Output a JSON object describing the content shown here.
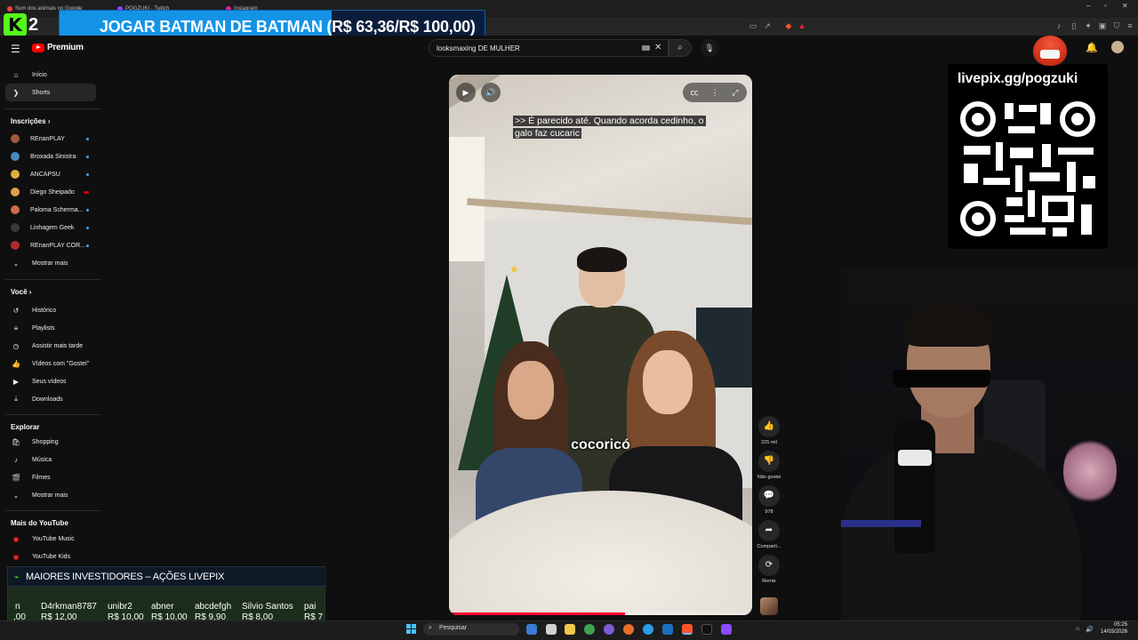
{
  "browser": {
    "tabs": [
      {
        "label": "Som dos animais no Google"
      },
      {
        "label": "POGZUKI - Twitch"
      },
      {
        "label": "Instagram"
      }
    ]
  },
  "stream_banner": {
    "brand": "K2",
    "text": "JOGAR BATMAN DE BATMAN (R$ 63,36/R$ 100,00)",
    "progress_fraction": 0.634
  },
  "header": {
    "logo_text": "Premium",
    "search_value": "looksmaxing DE MULHER"
  },
  "sidebar": {
    "top": [
      {
        "label": "Início",
        "icon": "home-icon"
      },
      {
        "label": "Shorts",
        "icon": "shorts-icon",
        "active": true
      }
    ],
    "subscriptions_title": "Inscrições",
    "subscriptions": [
      {
        "label": "REnanPLAY",
        "color": "#a05a3a",
        "indicator": "live-dot"
      },
      {
        "label": "Broxada Sinistra",
        "color": "#4a8bbd",
        "indicator": "live-dot"
      },
      {
        "label": "ANCAPSU",
        "color": "#e0b13a",
        "indicator": "live-dot"
      },
      {
        "label": "Diego Sheipado",
        "color": "#e0a04a",
        "indicator": "live-red"
      },
      {
        "label": "Paloma Scherma...",
        "color": "#d06a4a",
        "indicator": "live-dot"
      },
      {
        "label": "Linhagem Geek",
        "color": "#3a3a3a",
        "indicator": "live-dot"
      },
      {
        "label": "REnanPLAY COR...",
        "color": "#b02a2a",
        "indicator": "live-dot"
      }
    ],
    "show_more_1": "Mostrar mais",
    "you_title": "Você",
    "you_items": [
      {
        "label": "Histórico",
        "icon": "history-icon"
      },
      {
        "label": "Playlists",
        "icon": "playlists-icon"
      },
      {
        "label": "Assistir mais tarde",
        "icon": "watch-later-icon"
      },
      {
        "label": "Vídeos com \"Gostei\"",
        "icon": "like-icon"
      },
      {
        "label": "Seus vídeos",
        "icon": "your-videos-icon"
      },
      {
        "label": "Downloads",
        "icon": "download-icon"
      }
    ],
    "explore_title": "Explorar",
    "explore_items": [
      {
        "label": "Shopping",
        "icon": "shopping-icon"
      },
      {
        "label": "Música",
        "icon": "music-icon"
      },
      {
        "label": "Filmes",
        "icon": "movies-icon"
      }
    ],
    "show_more_2": "Mostrar mais",
    "more_title": "Mais do YouTube",
    "more_items": [
      {
        "label": "YouTube Music",
        "icon": "youtube-music-icon"
      },
      {
        "label": "YouTube Kids",
        "icon": "youtube-kids-icon"
      }
    ]
  },
  "short": {
    "caption": ">> É parecido até. Quando acorda cedinho, o galo faz cucaric",
    "subtitle": "cocoricó",
    "progress_fraction": 0.58,
    "actions": [
      {
        "icon": "thumbs-up-icon",
        "label": "225 mil"
      },
      {
        "icon": "thumbs-down-icon",
        "label": "Não gostei"
      },
      {
        "icon": "comment-icon",
        "label": "978"
      },
      {
        "icon": "share-icon",
        "label": "Comparti..."
      },
      {
        "icon": "remix-icon",
        "label": "Remix"
      }
    ]
  },
  "livepix": {
    "url": "livepix.gg/pogzuki"
  },
  "investors": {
    "title": "MAIORES INVESTIDORES – AÇÕES LIVEPIX",
    "entries": [
      {
        "name": "n",
        "amount": ",00"
      },
      {
        "name": "D4rkman8787",
        "amount": "R$ 12,00"
      },
      {
        "name": "unibr2",
        "amount": "R$ 10,00"
      },
      {
        "name": "abner",
        "amount": "R$ 10,00"
      },
      {
        "name": "abcdefgh",
        "amount": "R$ 9,90"
      },
      {
        "name": "Silvio Santos",
        "amount": "R$ 8,00"
      },
      {
        "name": "pai",
        "amount": "R$ 7"
      }
    ]
  },
  "taskbar": {
    "search_placeholder": "Pesquisar",
    "time": "05:25",
    "date": "14/03/2026"
  }
}
